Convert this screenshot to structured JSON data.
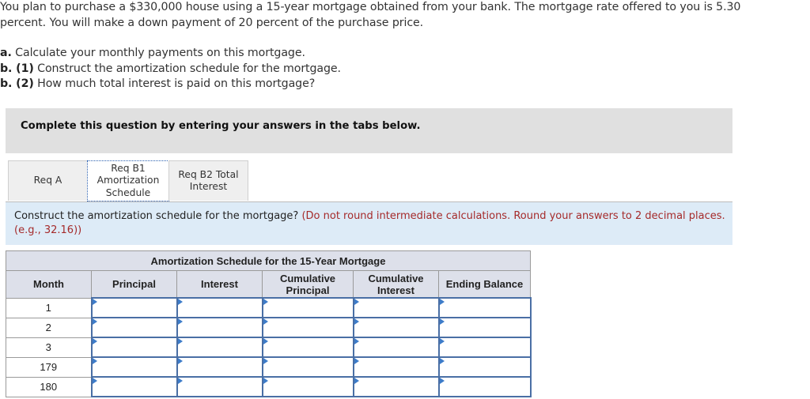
{
  "problem": {
    "intro_line1": "You plan to purchase a $330,000 house using a 15-year mortgage obtained from your bank. The mortgage rate offered to you is 5.30",
    "intro_line2": "percent. You will make a down payment of 20 percent of the purchase price.",
    "parts": [
      {
        "label": "a.",
        "text": " Calculate your monthly payments on this mortgage."
      },
      {
        "label": "b. (1)",
        "text": " Construct the amortization schedule for the mortgage."
      },
      {
        "label": "b. (2)",
        "text": " How much total interest is paid on this mortgage?"
      }
    ]
  },
  "banner": {
    "text": "Complete this question by entering your answers in the tabs below."
  },
  "tabs": [
    {
      "line1": "Req A",
      "line2": "",
      "line3": "",
      "active": false
    },
    {
      "line1": "Req B1",
      "line2": "Amortization",
      "line3": "Schedule",
      "active": true
    },
    {
      "line1": "Req B2 Total",
      "line2": "Interest",
      "line3": "",
      "active": false
    }
  ],
  "instructions": {
    "main": "Construct the amortization schedule for the mortgage? ",
    "note": "(Do not round intermediate calculations. Round your answers to 2 decimal places. (e.g., 32.16))"
  },
  "table": {
    "title": "Amortization Schedule for the 15-Year Mortgage",
    "columns": [
      {
        "line1": "Month",
        "line2": ""
      },
      {
        "line1": "Principal",
        "line2": ""
      },
      {
        "line1": "Interest",
        "line2": ""
      },
      {
        "line1": "Cumulative",
        "line2": "Principal"
      },
      {
        "line1": "Cumulative",
        "line2": "Interest"
      },
      {
        "line1": "Ending Balance",
        "line2": ""
      }
    ],
    "rows": [
      {
        "month": "1",
        "principal": "",
        "interest": "",
        "cum_principal": "",
        "cum_interest": "",
        "ending_balance": ""
      },
      {
        "month": "2",
        "principal": "",
        "interest": "",
        "cum_principal": "",
        "cum_interest": "",
        "ending_balance": ""
      },
      {
        "month": "3",
        "principal": "",
        "interest": "",
        "cum_principal": "",
        "cum_interest": "",
        "ending_balance": ""
      },
      {
        "month": "179",
        "principal": "",
        "interest": "",
        "cum_principal": "",
        "cum_interest": "",
        "ending_balance": ""
      },
      {
        "month": "180",
        "principal": "",
        "interest": "",
        "cum_principal": "",
        "cum_interest": "",
        "ending_balance": ""
      }
    ]
  },
  "colors": {
    "banner_bg": "#e0e0e0",
    "instructions_bg": "#ddebf7",
    "note_red": "#a52a2a",
    "input_border": "#4a6fa5",
    "header_bg": "#dde0ea"
  }
}
